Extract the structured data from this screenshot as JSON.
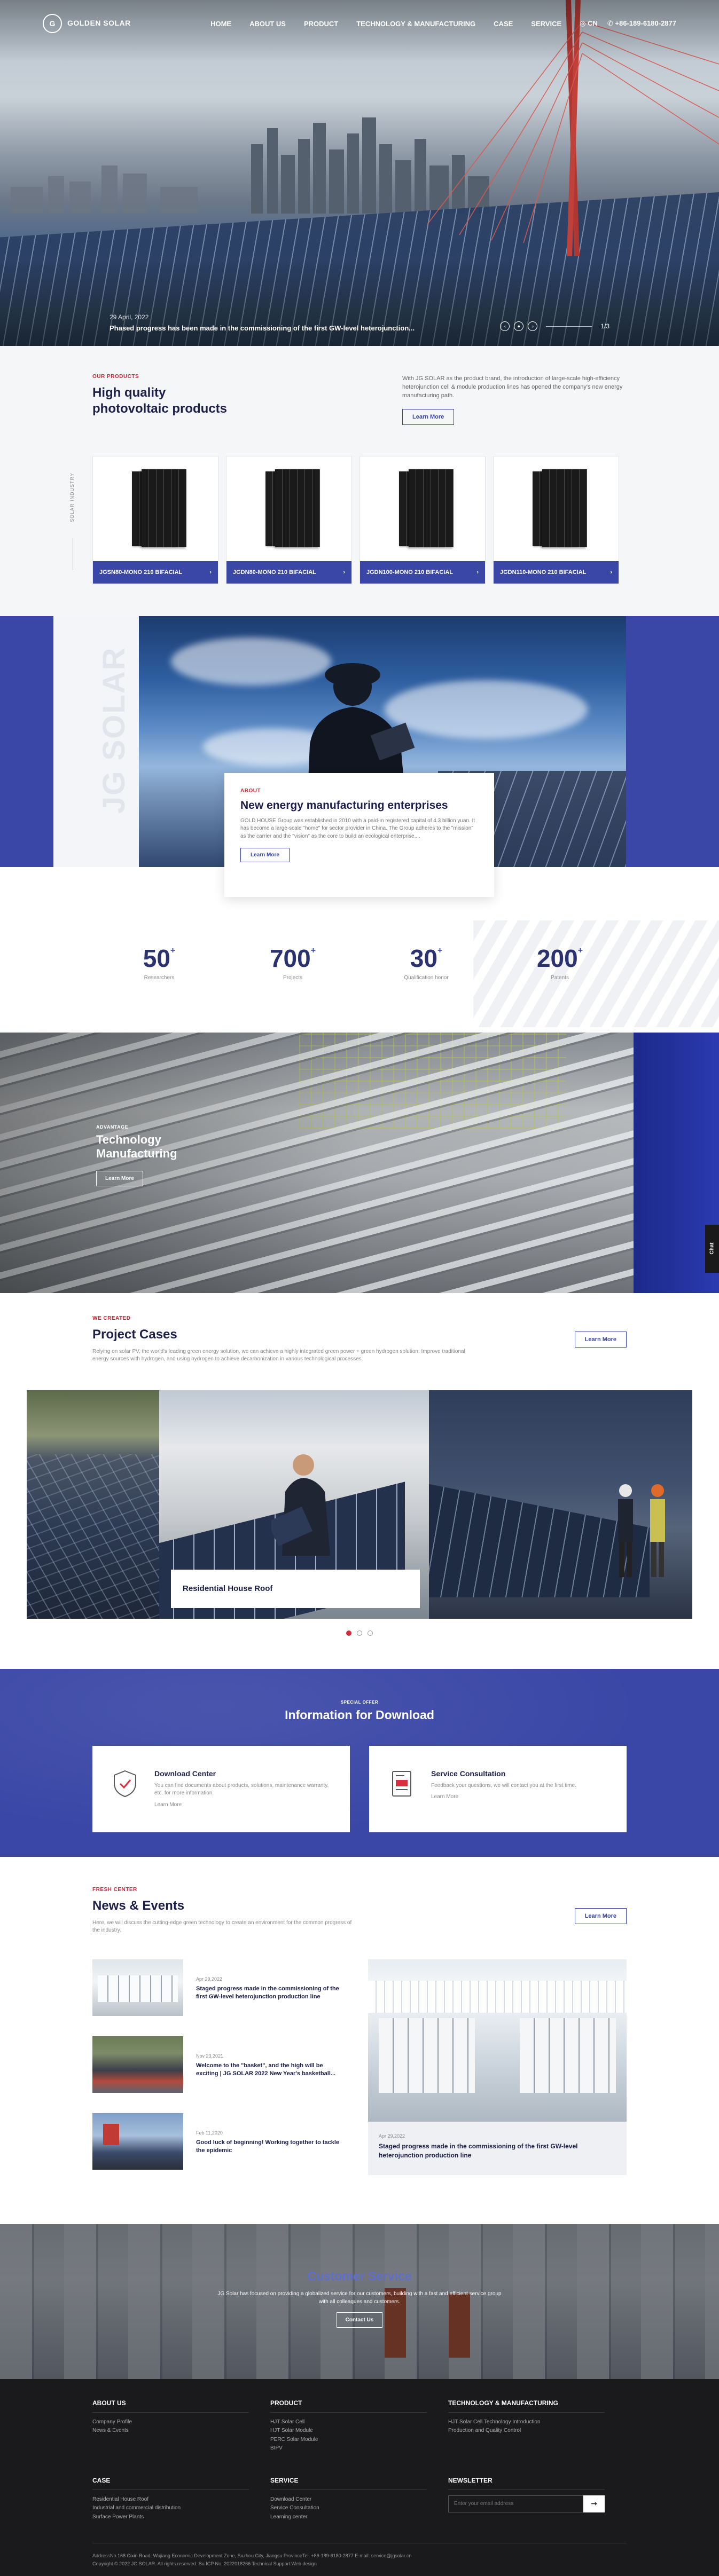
{
  "nav": {
    "logo_mark": "G",
    "logo_name": "GOLDEN SOLAR",
    "logo_sub": "",
    "items": [
      "HOME",
      "ABOUT US",
      "PRODUCT",
      "TECHNOLOGY & MANUFACTURING",
      "CASE",
      "SERVICE"
    ],
    "lang": "CN",
    "phone": "+86-189-6180-2877"
  },
  "hero": {
    "date": "29 April, 2022",
    "title": "Phased progress has been made in the commissioning of the first GW-level heterojunction...",
    "counter": "1/3"
  },
  "products": {
    "eyebrow": "OUR PRODUCTS",
    "title_line1": "High quality",
    "title_line2": "photovoltaic products",
    "description": "With JG SOLAR as the product brand, the introduction of large-scale high-efficiency heterojunction cell & module production lines has opened the company's new energy manufacturing path.",
    "more": "Learn More",
    "side_label": "SOLAR INDUSTRY",
    "items": [
      {
        "name": "JGSN80-MONO 210 BIFACIAL"
      },
      {
        "name": "JGDN80-MONO 210 BIFACIAL"
      },
      {
        "name": "JGDN100-MONO 210 BIFACIAL"
      },
      {
        "name": "JGDN110-MONO 210 BIFACIAL"
      }
    ]
  },
  "about": {
    "watermark": "JG SOLAR",
    "eyebrow": "ABOUT",
    "title": "New energy manufacturing enterprises",
    "text": "GOLD HOUSE Group was established in 2010 with a paid-in registered capital of 4.3 billion yuan. It has become a large-scale \"home\" for sector provider in China. The Group adheres to the \"mission\" as the carrier and the \"vision\" as the core to build an ecological enterprise....",
    "more": "Learn More",
    "stats": [
      {
        "num": "50",
        "sup": "+",
        "label": "Researchers"
      },
      {
        "num": "700",
        "sup": "+",
        "label": "Projects"
      },
      {
        "num": "30",
        "sup": "+",
        "label": "Qualification honor"
      },
      {
        "num": "200",
        "sup": "+",
        "label": "Patents"
      }
    ]
  },
  "tech": {
    "eyebrow": "ADVANTAGE",
    "title_line1": "Technology",
    "title_line2": "Manufacturing",
    "more": "Learn More",
    "chat": "Chat"
  },
  "cases": {
    "eyebrow": "WE CREATED",
    "title": "Project Cases",
    "description": "Relying on solar PV, the world's leading green energy solution, we can achieve a highly integrated green power + green hydrogen solution. Improve traditional energy sources with hydrogen, and using hydrogen to achieve decarbonization in various technological processes.",
    "more": "Learn More",
    "caption": "Residential House Roof"
  },
  "download": {
    "eyebrow": "SPECIAL OFFER",
    "title": "Information for Download",
    "cards": [
      {
        "title": "Download Center",
        "desc": "You can find documents about products, solutions, maintenance warranty, etc. for more information.",
        "more": "Learn More"
      },
      {
        "title": "Service Consultation",
        "desc": "Feedback your questions, we will contact you at the first time.",
        "more": "Learn More"
      }
    ]
  },
  "news": {
    "eyebrow": "FRESH CENTER",
    "title": "News & Events",
    "description": "Here, we will discuss the cutting-edge green technology to create an environment for the common progress of the industry.",
    "more": "Learn More",
    "items": [
      {
        "date": "Apr 29,2022",
        "title": "Staged progress made in the commissioning of the first GW-level heterojunction production line"
      },
      {
        "date": "Nov 23,2021",
        "title": "Welcome to the \"basket\", and the high will be exciting | JG SOLAR 2022 New Year's basketball..."
      },
      {
        "date": "Feb 11,2020",
        "title": "Good luck of beginning! Working together to tackle the epidemic"
      }
    ],
    "feature": {
      "date": "Apr 29,2022",
      "title": "Staged progress made in the commissioning of the first GW-level heterojunction production line"
    }
  },
  "service": {
    "title": "Customer Service",
    "text": "JG Solar has focused on providing a globalized service for our customers, building with a fast and efficient service group with all colleagues and customers.",
    "more": "Contact Us"
  },
  "footer": {
    "cols_top": [
      {
        "title": "ABOUT US",
        "links": [
          "Company Profile",
          "News & Events"
        ]
      },
      {
        "title": "PRODUCT",
        "links": [
          "HJT Solar Cell",
          "HJT Solar Module",
          "PERC Solar Module",
          "BIPV"
        ]
      },
      {
        "title": "TECHNOLOGY & MANUFACTURING",
        "links": [
          "HJT Solar Cell Technology Introduction",
          "Production and Quality Control"
        ]
      }
    ],
    "cols_bottom": [
      {
        "title": "CASE",
        "links": [
          "Residential House Roof",
          "Industrial and commercial distribution",
          "Surface Power Plants"
        ]
      },
      {
        "title": "SERVICE",
        "links": [
          "Download Center",
          "Service Consultation",
          "Learning center"
        ]
      }
    ],
    "newsletter_title": "NEWSLETTER",
    "newsletter_placeholder": "Enter your email address",
    "newsletter_button": "→",
    "address": "AddressNo.168 Cixin Road, Wujiang Economic Development Zone, Suzhou City, Jiangsu ProvinceTel: +86-189-6180-2877 E-mail: service@jgsolar.cn",
    "copyright": "Copyright © 2022 JG SOLAR. All rights reserved. Su ICP No. 2022018266 Technical Support:Web design"
  }
}
